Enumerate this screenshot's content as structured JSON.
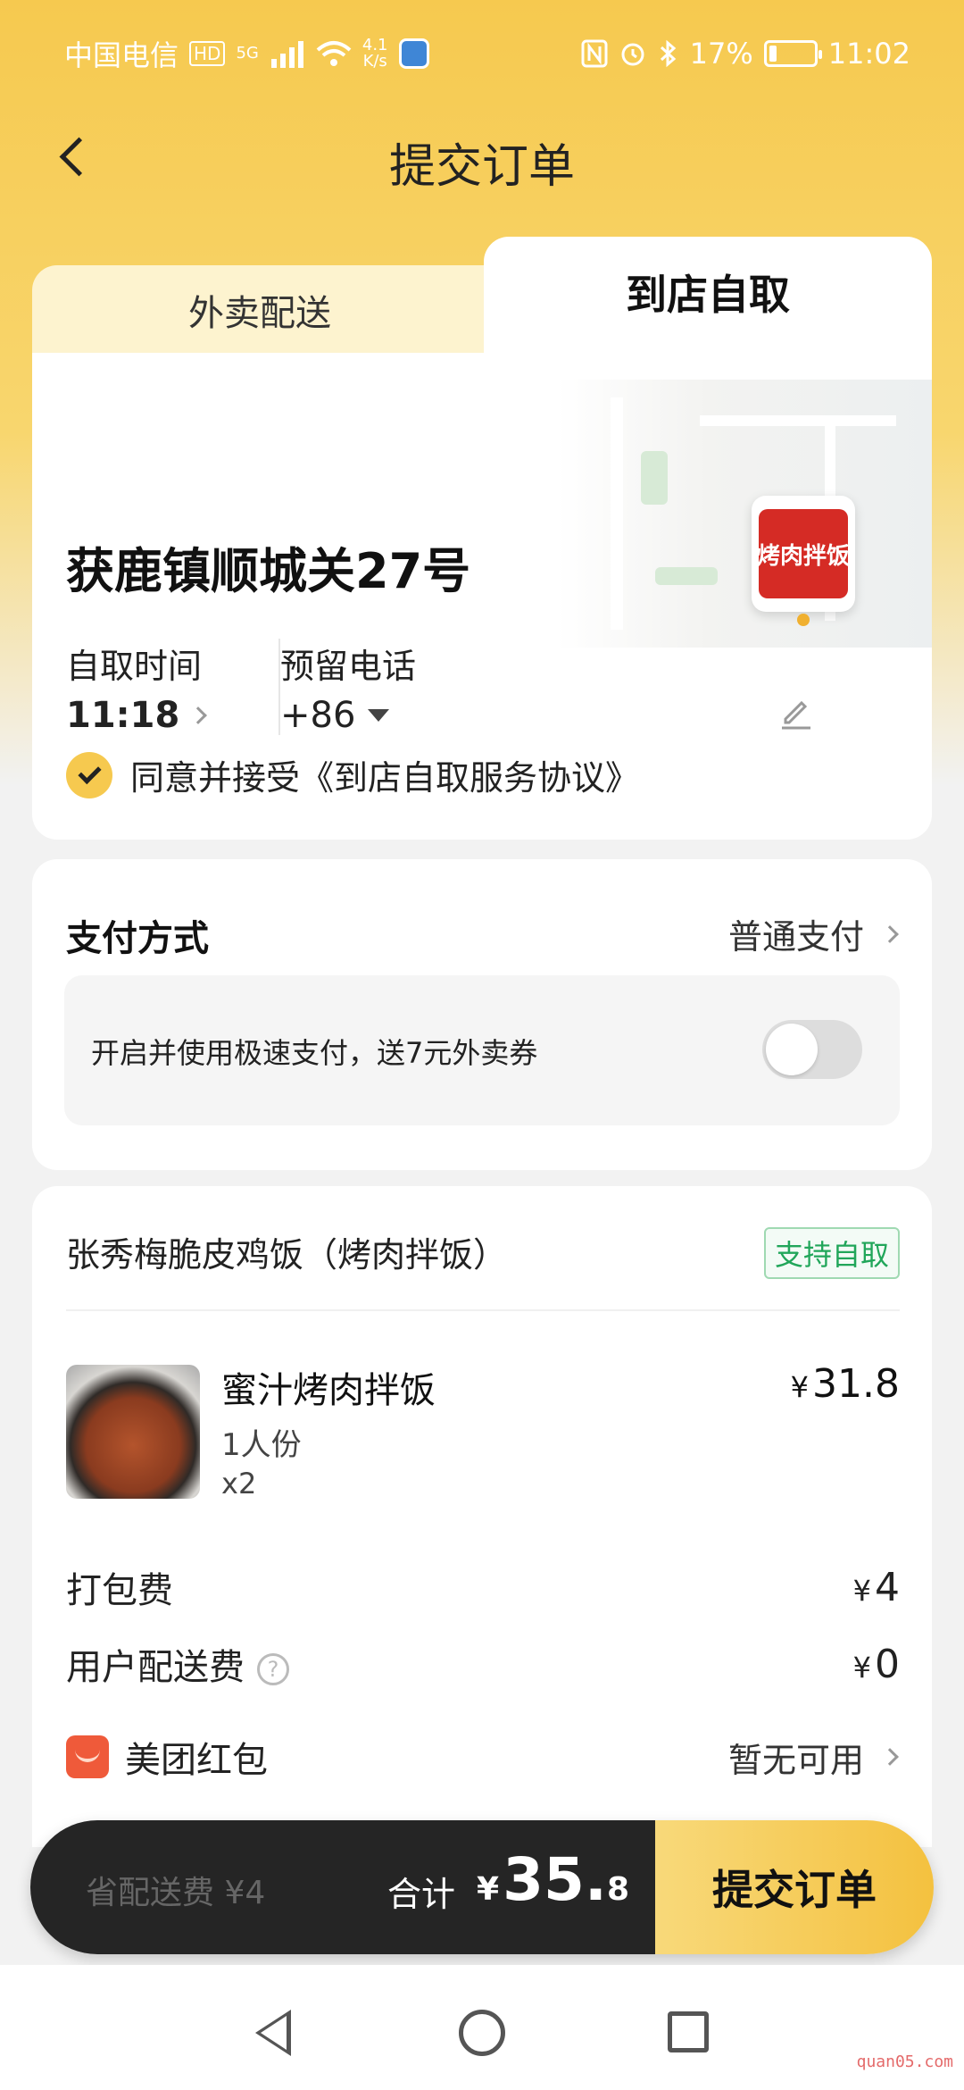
{
  "status_bar": {
    "carrier": "中国电信",
    "hd_badge": "HD",
    "network": "5G",
    "speed": "4.1\nK/s",
    "battery_percent": "17%",
    "battery_level": 0.17,
    "time": "11:02"
  },
  "header": {
    "title": "提交订单"
  },
  "tabs": [
    {
      "label": "外卖配送",
      "active": false
    },
    {
      "label": "到店自取",
      "active": true
    }
  ],
  "pickup": {
    "address": "获鹿镇顺城关27号",
    "shop_logo_text": "烤肉拌饭",
    "time_label": "自取时间",
    "time_value": "11:18",
    "phone_label": "预留电话",
    "phone_value": "+86",
    "agreement": "同意并接受《到店自取服务协议》"
  },
  "payment": {
    "title": "支付方式",
    "method": "普通支付",
    "fast_pay_text": "开启并使用极速支付，送7元外卖券",
    "fast_pay_enabled": false
  },
  "order": {
    "shop_name": "张秀梅脆皮鸡饭（烤肉拌饭）",
    "badge": "支持自取",
    "item": {
      "name": "蜜汁烤肉拌饭",
      "spec": "1人份",
      "qty": "x2",
      "currency": "¥",
      "price": "31.8"
    },
    "packing_fee_label": "打包费",
    "packing_fee": "4",
    "delivery_fee_label": "用户配送费",
    "delivery_fee": "0",
    "help_icon": "?",
    "red_packet_label": "美团红包",
    "red_packet_value": "暂无可用"
  },
  "action_bar": {
    "save_text": "省配送费 ¥4",
    "total_label": "合计",
    "currency": "¥",
    "total_int": "35.",
    "total_dec": "8",
    "submit_label": "提交订单"
  },
  "watermark": "quan05.com",
  "colors": {
    "accent": "#f6c94f",
    "badge_green": "#21a65a",
    "dark_bar": "#252525",
    "red_packet": "#ef5a3a"
  }
}
